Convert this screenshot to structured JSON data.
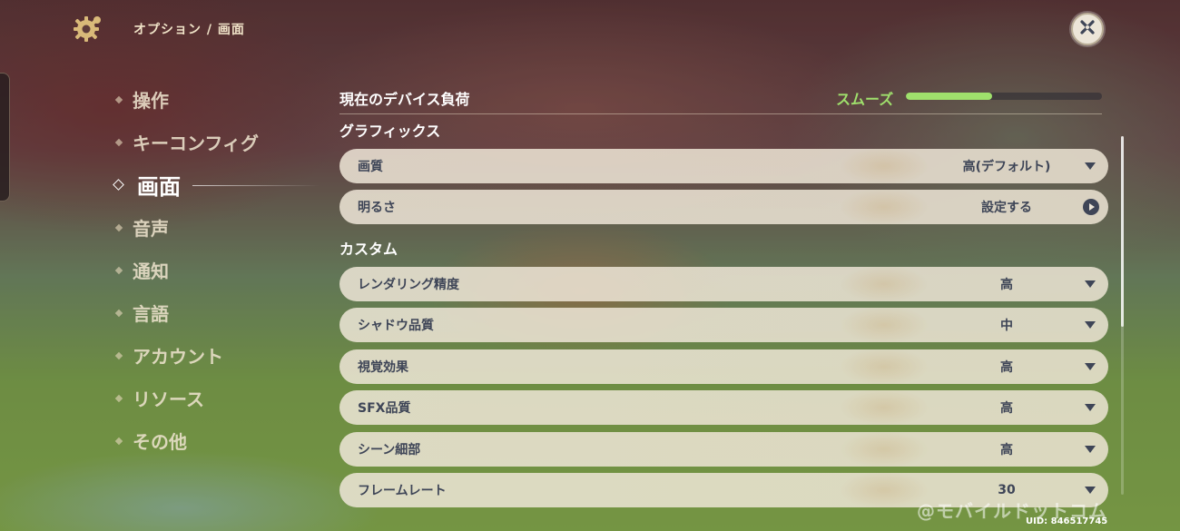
{
  "header": {
    "breadcrumb": "オプション / 画面",
    "gear_icon": "gear-icon",
    "close_icon": "close-icon"
  },
  "nav": {
    "items": [
      {
        "label": "操作",
        "active": false
      },
      {
        "label": "キーコンフィグ",
        "active": false
      },
      {
        "label": "画面",
        "active": true
      },
      {
        "label": "音声",
        "active": false
      },
      {
        "label": "通知",
        "active": false
      },
      {
        "label": "言語",
        "active": false
      },
      {
        "label": "アカウント",
        "active": false
      },
      {
        "label": "リソース",
        "active": false
      },
      {
        "label": "その他",
        "active": false
      }
    ]
  },
  "device_load": {
    "label": "現在のデバイス負荷",
    "status": "スムーズ",
    "level": 0.44,
    "color": "#9fe06c"
  },
  "graphics": {
    "title": "グラフィックス",
    "rows": [
      {
        "label": "画質",
        "value": "高(デフォルト)",
        "control": "dropdown"
      },
      {
        "label": "明るさ",
        "value": "設定する",
        "control": "button"
      }
    ]
  },
  "custom": {
    "title": "カスタム",
    "rows": [
      {
        "label": "レンダリング精度",
        "value": "高",
        "control": "dropdown"
      },
      {
        "label": "シャドウ品質",
        "value": "中",
        "control": "dropdown"
      },
      {
        "label": "視覚効果",
        "value": "高",
        "control": "dropdown"
      },
      {
        "label": "SFX品質",
        "value": "高",
        "control": "dropdown"
      },
      {
        "label": "シーン細部",
        "value": "高",
        "control": "dropdown"
      },
      {
        "label": "フレームレート",
        "value": "30",
        "control": "dropdown"
      }
    ]
  },
  "watermark": "@モバイルドットコム",
  "uid": "UID: 846517745",
  "colors": {
    "row_bg": "#ece5d8",
    "row_text": "#3e4557",
    "accent_gold": "#d9b979"
  }
}
